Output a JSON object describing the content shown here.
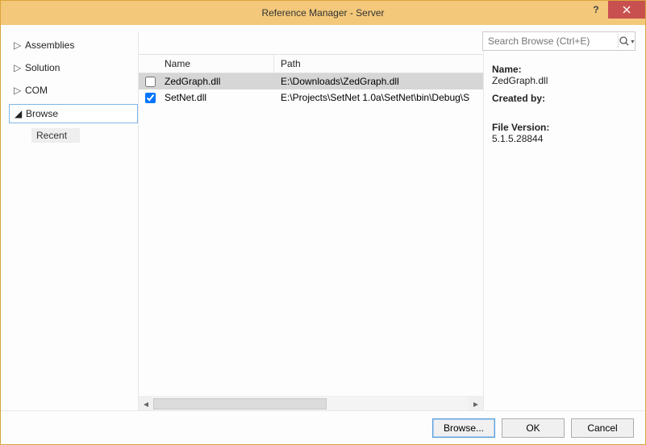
{
  "window": {
    "title": "Reference Manager - Server"
  },
  "search": {
    "placeholder": "Search Browse (Ctrl+E)"
  },
  "sidebar": {
    "items": [
      {
        "label": "Assemblies",
        "expanded": false
      },
      {
        "label": "Solution",
        "expanded": false
      },
      {
        "label": "COM",
        "expanded": false
      },
      {
        "label": "Browse",
        "expanded": true,
        "selected": true
      }
    ],
    "sub": {
      "label": "Recent"
    }
  },
  "columns": {
    "name": "Name",
    "path": "Path"
  },
  "rows": [
    {
      "checked": false,
      "selected": true,
      "name": "ZedGraph.dll",
      "path": "E:\\Downloads\\ZedGraph.dll"
    },
    {
      "checked": true,
      "selected": false,
      "name": "SetNet.dll",
      "path": "E:\\Projects\\SetNet 1.0a\\SetNet\\bin\\Debug\\S"
    }
  ],
  "details": {
    "name_label": "Name:",
    "name_value": "ZedGraph.dll",
    "created_label": "Created by:",
    "version_label": "File Version:",
    "version_value": "5.1.5.28844"
  },
  "buttons": {
    "browse": "Browse...",
    "ok": "OK",
    "cancel": "Cancel"
  }
}
